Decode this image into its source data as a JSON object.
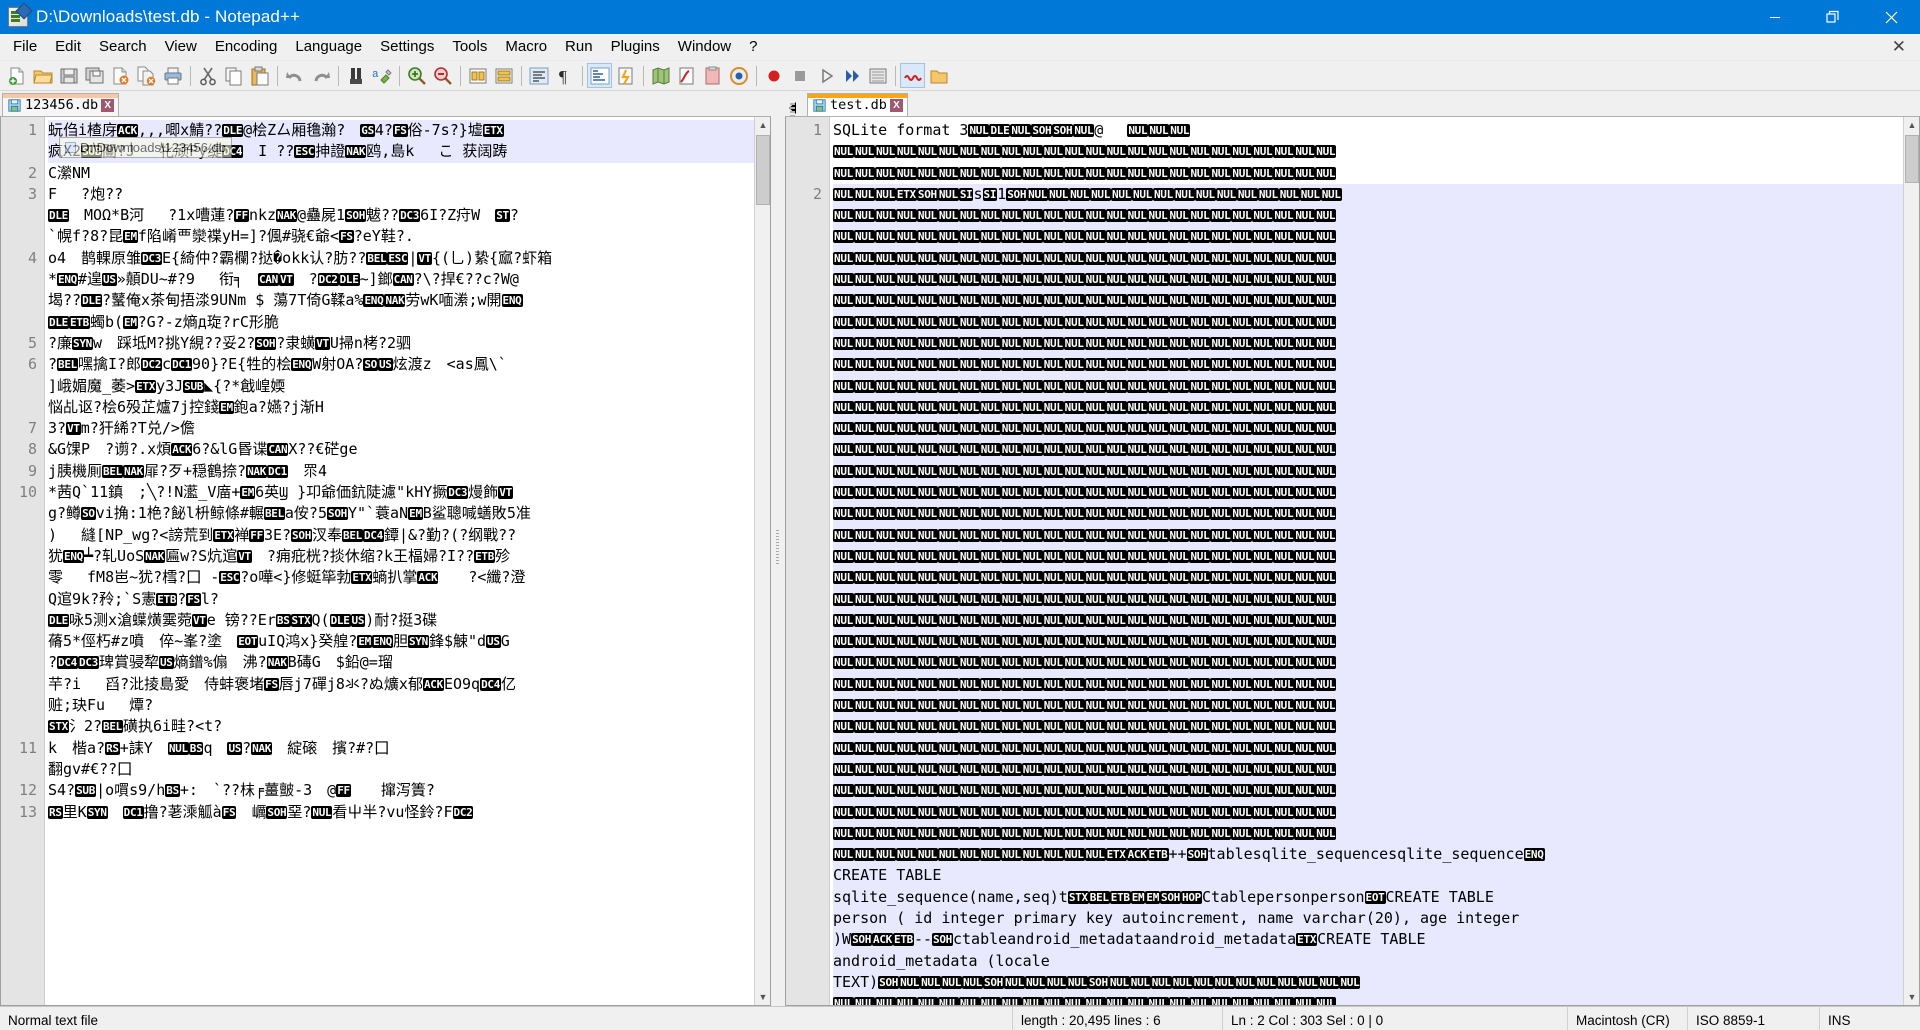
{
  "window": {
    "title": "D:\\Downloads\\test.db - Notepad++",
    "icon": "notepad-plus-plus-icon",
    "accent_color": "#0078d7",
    "controls": {
      "minimize": "minimize-icon",
      "maximize": "restore-icon",
      "close": "close-icon"
    }
  },
  "menubar": {
    "items": [
      "File",
      "Edit",
      "Search",
      "View",
      "Encoding",
      "Language",
      "Settings",
      "Tools",
      "Macro",
      "Run",
      "Plugins",
      "Window",
      "?"
    ],
    "close_document": "✕"
  },
  "toolbar": {
    "icons": [
      "new-file-icon",
      "open-file-icon",
      "save-icon",
      "save-all-icon",
      "close-file-icon",
      "close-all-files-icon",
      "print-icon",
      "sep",
      "cut-icon",
      "copy-icon",
      "paste-icon",
      "sep",
      "undo-icon",
      "redo-icon",
      "sep",
      "find-icon",
      "replace-icon",
      "sep",
      "zoom-in-icon",
      "zoom-out-icon",
      "sep",
      "sync-vertical-scrolling-icon",
      "sync-horizontal-scrolling-icon",
      "sep",
      "word-wrap-icon",
      "show-all-characters-icon",
      "sep",
      "indent-guideline-icon",
      "user-defined-language-icon",
      "sep",
      "document-map-icon",
      "function-list-icon",
      "folder-as-workspace-icon",
      "monitoring-icon",
      "sep",
      "start-recording-icon",
      "stop-recording-icon",
      "playback-icon",
      "run-macro-multiple-times-icon",
      "save-current-recorded-macro-icon",
      "sep",
      "squiggly-underline-icon",
      "open-folder-icon"
    ]
  },
  "left_pane": {
    "tab": {
      "label": "123456.db",
      "icon": "save-icon",
      "close": "X",
      "state": "inactive"
    },
    "tooltip": {
      "text": "D:\\Downloads\\123456.db",
      "icon": "file-icon"
    },
    "gutter_lines": [
      "1",
      "2",
      "3",
      "4",
      "5",
      "6",
      "7",
      "8",
      "9",
      "10",
      "11",
      "12",
      "13"
    ],
    "lines": [
      {
        "n": "1",
        "selected": true,
        "parts": [
          {
            "t": "蚖㑇i楂庌"
          },
          {
            "c": "ACK"
          },
          {
            "t": ",,,唧x鯖??"
          },
          {
            "c": "DLE"
          },
          {
            "t": "@桧Z厶厢氇瀚?　"
          },
          {
            "c": "GS"
          },
          {
            "t": "4?"
          },
          {
            "c": "FS"
          },
          {
            "t": "俗-7s?}墟"
          },
          {
            "c": "ETX"
          },
          {
            "t": "\n疯X2"
          },
          {
            "c": "SUB"
          },
          {
            "t": "闦?J　 牝顽Py缇"
          },
          {
            "c": "DC4"
          },
          {
            "t": "　I ??"
          },
          {
            "c": "ESC"
          },
          {
            "t": "抻證"
          },
          {
            "c": "NAK"
          },
          {
            "t": "鸥,島k　 こ 获阔踌"
          }
        ]
      },
      {
        "n": "2",
        "selected": false,
        "parts": [
          {
            "t": "C瀠NM"
          }
        ]
      },
      {
        "n": "3",
        "selected": false,
        "parts": [
          {
            "t": "F 　?炮??"
          },
          {
            "t": "\n"
          },
          {
            "c": "DLE"
          },
          {
            "t": "　MOΩ*B河　 ?1x嘈蓮?"
          },
          {
            "c": "FF"
          },
          {
            "t": "nkz"
          },
          {
            "c": "NAK"
          },
          {
            "t": "@蠱屍1"
          },
          {
            "c": "SOH"
          },
          {
            "t": "魃??"
          },
          {
            "c": "DC3"
          },
          {
            "t": "6I?Z疛W　"
          },
          {
            "c": "ST"
          },
          {
            "t": "?"
          },
          {
            "t": "\n`幌f?8?昆"
          },
          {
            "c": "EM"
          },
          {
            "t": "f陷崤覀灓褋yH=]?偑#骁€爺<"
          },
          {
            "c": "FS"
          },
          {
            "t": "?eY鞋?."
          }
        ]
      },
      {
        "n": "4",
        "selected": false,
        "parts": [
          {
            "t": "o4　鹊輠原雏"
          },
          {
            "c": "DC3"
          },
          {
            "t": "E{綺仲?霸欄?挞�okk认?肪??"
          },
          {
            "c": "BEL"
          },
          {
            "c": "ESC"
          },
          {
            "t": "|"
          },
          {
            "c": "VT"
          },
          {
            "t": "{(乚)絷{寙?虾箱"
          },
          {
            "t": "\n*"
          },
          {
            "c": "ENQ"
          },
          {
            "t": "#遑"
          },
          {
            "c": "US"
          },
          {
            "t": "»顤DU~#?9　 衔╕　"
          },
          {
            "c": "CAN"
          },
          {
            "c": "VT"
          },
          {
            "t": "　?"
          },
          {
            "c": "DC2"
          },
          {
            "c": "DLE"
          },
          {
            "t": "~]鎯"
          },
          {
            "c": "CAN"
          },
          {
            "t": "?\\?捍€??c?W@"
          },
          {
            "t": "\n堨??"
          },
          {
            "c": "DLE"
          },
          {
            "t": "?鼜俺x茶甸捂渁9UNm $ 蕩7T倚G鞣a%"
          },
          {
            "c": "ENQ"
          },
          {
            "c": "NAK"
          },
          {
            "t": "劳wK喕潫;w開"
          },
          {
            "c": "ENQ"
          },
          {
            "t": "\n"
          },
          {
            "c": "DLE"
          },
          {
            "c": "ETB"
          },
          {
            "t": "蠋b("
          },
          {
            "c": "EM"
          },
          {
            "t": "?G?-z熵д琁?rC形脆"
          }
        ]
      },
      {
        "n": "5",
        "selected": false,
        "parts": [
          {
            "t": "?廉"
          },
          {
            "c": "SYN"
          },
          {
            "t": "w　踩坻M?挑Y絸??妥2?"
          },
          {
            "c": "SOH"
          },
          {
            "t": "?隶蟥"
          },
          {
            "c": "VT"
          },
          {
            "t": "U掃n栲?2驷"
          }
        ]
      },
      {
        "n": "6",
        "selected": false,
        "parts": [
          {
            "t": "?"
          },
          {
            "c": "BEL"
          },
          {
            "t": "嘿擒I?郎"
          },
          {
            "c": "DC2"
          },
          {
            "t": "c"
          },
          {
            "c": "DC1"
          },
          {
            "t": "90}?E{牲的桧"
          },
          {
            "c": "ENQ"
          },
          {
            "t": "W射OA?"
          },
          {
            "c": "SO"
          },
          {
            "c": "US"
          },
          {
            "t": "炫渡z　<as鳳\\`"
          },
          {
            "t": "\n]峨媚魔_萎>"
          },
          {
            "c": "ETX"
          },
          {
            "t": "y3J"
          },
          {
            "c": "SUB"
          },
          {
            "t": "◣{?*戧崲媆"
          },
          {
            "t": "\n悩乩讴?桧6殁芷爐7j控錢"
          },
          {
            "c": "EM"
          },
          {
            "t": "鉋a?嬿?j渐H"
          }
        ]
      },
      {
        "n": "7",
        "selected": false,
        "parts": [
          {
            "t": "3?"
          },
          {
            "c": "VT"
          },
          {
            "t": "m?犴絺?T兑/>儋"
          }
        ]
      },
      {
        "n": "8",
        "selected": false,
        "parts": [
          {
            "t": "&G馃P　?谫?.x煩"
          },
          {
            "c": "ACK"
          },
          {
            "t": "6?&lG昬谍"
          },
          {
            "c": "CAN"
          },
          {
            "t": "X??€硭ge"
          }
        ]
      },
      {
        "n": "9",
        "selected": false,
        "parts": [
          {
            "t": "j胰機厠"
          },
          {
            "c": "BEL"
          },
          {
            "c": "NAK"
          },
          {
            "t": "屝?歹+穏鶴捺?"
          },
          {
            "c": "NAK"
          },
          {
            "c": "DC1"
          },
          {
            "t": "　眔4"
          }
        ]
      },
      {
        "n": "10",
        "selected": false,
        "parts": [
          {
            "t": "*茜Q`11鎮　;╲?!N灆_V庿+"
          },
          {
            "c": "EM"
          },
          {
            "t": "6英Ϣ }卭爺価鈧陡濾\"kHY撅"
          },
          {
            "c": "DC3"
          },
          {
            "t": "熳飾"
          },
          {
            "c": "VT"
          },
          {
            "t": "\ng?鳟"
          },
          {
            "c": "SO"
          },
          {
            "t": "vi捔:1栬?飶l枡鲸條#輾"
          },
          {
            "c": "BEL"
          },
          {
            "t": "a侒?5"
          },
          {
            "c": "SOH"
          },
          {
            "t": "Y\"`蓑aN"
          },
          {
            "c": "EM"
          },
          {
            "t": "B鲨聰喊蟮敗5准"
          },
          {
            "t": "\n)　 縫[NP_wg?<謗荒到"
          },
          {
            "c": "ETX"
          },
          {
            "t": "褝"
          },
          {
            "c": "FF"
          },
          {
            "t": "3E?"
          },
          {
            "c": "SOH"
          },
          {
            "t": "汊奉"
          },
          {
            "c": "BEL"
          },
          {
            "c": "DC4"
          },
          {
            "t": "鐔|&?勤?(?纲戰??"
          },
          {
            "t": "\n犹"
          },
          {
            "c": "ENQ"
          },
          {
            "t": "┷?轧UoS"
          },
          {
            "c": "NAK"
          },
          {
            "t": "匾w?S炕逭"
          },
          {
            "c": "VT"
          },
          {
            "t": "　?痈疪桄?掞休缩?k王楅婦?I??"
          },
          {
            "c": "ETB"
          },
          {
            "t": "殄"
          },
          {
            "t": "\n零　 fM8岜~犹?樰?囗 -"
          },
          {
            "c": "ESC"
          },
          {
            "t": "?o嘩<}修蜓筚勃"
          },
          {
            "c": "ETX"
          },
          {
            "t": "螪扒掌"
          },
          {
            "c": "ACK"
          },
          {
            "t": "　　?<纖?澄"
          },
          {
            "t": "\nQ逭9k?矝;`S憲"
          },
          {
            "c": "ETB"
          },
          {
            "t": "?"
          },
          {
            "c": "FS"
          },
          {
            "t": "l?"
          },
          {
            "t": "\n"
          },
          {
            "c": "DLE"
          },
          {
            "t": "咏5测x滄蠂熿霙菀"
          },
          {
            "c": "VT"
          },
          {
            "t": "e 镑??Er"
          },
          {
            "c": "BS"
          },
          {
            "c": "STX"
          },
          {
            "t": "Q("
          },
          {
            "c": "DLE"
          },
          {
            "c": "US"
          },
          {
            "t": ")耐?挺3碟"
          },
          {
            "t": "\n蓨5*俓朽#z噴　倅~峯?塗　"
          },
          {
            "c": "EOT"
          },
          {
            "t": "uIQ鸿x}癸艎?"
          },
          {
            "c": "EM"
          },
          {
            "c": "ENQ"
          },
          {
            "t": "胆"
          },
          {
            "c": "SYN"
          },
          {
            "t": "鋒$觫\"d"
          },
          {
            "c": "US"
          },
          {
            "t": "G"
          },
          {
            "t": "\n?"
          },
          {
            "c": "DC4"
          },
          {
            "c": "DC3"
          },
          {
            "t": "琕賞骎犂"
          },
          {
            "c": "US"
          },
          {
            "t": "熵鐠%傓　沸?"
          },
          {
            "c": "NAK"
          },
          {
            "t": "B碡G　$鉛@=瑠"
          },
          {
            "t": "\n芉?i　 舀?沘掕島愛　侍蚌褒堵"
          },
          {
            "c": "FS"
          },
          {
            "t": "唇j7磾j8氺?ぬ爌x郁"
          },
          {
            "c": "ACK"
          },
          {
            "t": "EO9q"
          },
          {
            "c": "DC4"
          },
          {
            "t": "亿"
          },
          {
            "t": "\n赃;玦Fu　 燂?"
          }
        ]
      },
      {
        "n": "11",
        "selected": false,
        "parts": [
          {
            "c": "STX"
          },
          {
            "t": "氵2?"
          },
          {
            "c": "BEL"
          },
          {
            "t": "磺执6i畦?<t?"
          },
          {
            "t": "\nk　楷a?"
          },
          {
            "c": "RS"
          },
          {
            "t": "+誄Y　"
          },
          {
            "c": "NUL"
          },
          {
            "c": "BS"
          },
          {
            "t": "q　"
          },
          {
            "c": "US"
          },
          {
            "t": "?"
          },
          {
            "c": "NAK"
          },
          {
            "t": "　綻磙　擯?#?囗"
          }
        ]
      },
      {
        "n": "12",
        "selected": false,
        "parts": [
          {
            "t": "翻gv#€??囗"
          }
        ]
      },
      {
        "n": "13",
        "selected": false,
        "parts": [
          {
            "t": "S4?"
          },
          {
            "c": "SUB"
          },
          {
            "t": "|o嘪s9/h"
          },
          {
            "c": "BS"
          },
          {
            "t": "+:　`??枺╒薑皽-3　@"
          },
          {
            "c": "FF"
          },
          {
            "t": "　　撺泻簀?"
          },
          {
            "t": "\n"
          },
          {
            "c": "RS"
          },
          {
            "t": "里K"
          },
          {
            "c": "SYN"
          },
          {
            "t": "　"
          },
          {
            "c": "DC1"
          },
          {
            "t": "撸?荖溗觚à"
          },
          {
            "c": "FS"
          },
          {
            "t": "　巁"
          },
          {
            "c": "SOH"
          },
          {
            "t": "堊?"
          },
          {
            "c": "NUL"
          },
          {
            "t": "看屮半?vu怪鈴?F"
          },
          {
            "c": "DC2"
          }
        ]
      }
    ]
  },
  "right_pane": {
    "tab": {
      "label": "test.db",
      "icon": "save-icon",
      "close": "X",
      "state": "active"
    },
    "gutter_lines": [
      "1",
      "2"
    ],
    "lines": [
      {
        "n": "1",
        "selected": false,
        "parts": [
          {
            "t": "SQLite format 3"
          },
          {
            "c": "NUL"
          },
          {
            "c": "DLE"
          },
          {
            "c": "NUL"
          },
          {
            "c": "SOH"
          },
          {
            "c": "SOH"
          },
          {
            "c": "NUL"
          },
          {
            "t": "@　 "
          },
          {
            "c": "NUL"
          },
          {
            "c": "NUL"
          },
          {
            "c": "NUL"
          }
        ]
      },
      {
        "n": "",
        "selected": false,
        "nul_row": 16,
        "tail": []
      },
      {
        "n": "",
        "selected": false,
        "nul_row": 16,
        "tail": []
      },
      {
        "n": "2",
        "selected": true,
        "parts": [
          {
            "c": "NUL"
          },
          {
            "c": "NUL"
          },
          {
            "c": "NUL"
          },
          {
            "c": "ETX"
          },
          {
            "c": "SOH"
          },
          {
            "c": "NUL"
          },
          {
            "c": "SI"
          },
          {
            "t": "s"
          },
          {
            "c": "SI"
          },
          {
            "t": "1"
          },
          {
            "c": "SOH"
          },
          {
            "c": "NUL"
          },
          {
            "c": "NUL"
          },
          {
            "c": "NUL"
          },
          {
            "c": "NUL"
          },
          {
            "c": "NUL"
          },
          {
            "c": "NUL"
          },
          {
            "c": "NUL"
          },
          {
            "c": "NUL"
          },
          {
            "c": "NUL"
          }
        ]
      }
    ],
    "sql_text": [
      "CREATE TABLE",
      "sqlite_sequence(name,seq)t",
      "person ( id integer primary key autoincrement, name varchar(20), age integer",
      ")W",
      "android_metadata (locale",
      "TEXT)"
    ],
    "sql_tokens": {
      "line2_ctrl": [
        "STX",
        "BEL",
        "ETB",
        "EM",
        "EM",
        "SOH",
        "HOP"
      ],
      "line2_after": "Ctablepersonperson",
      "line2_eot": "EOT",
      "line2_tail": "CREATE TABLE",
      "line4_ctrl": [
        "SOH",
        "ACK",
        "ETB"
      ],
      "line4_mid": "--",
      "line4_ctrl2": [
        "SOH"
      ],
      "line4_after": "ctableandroid_metadataandroid_metadata",
      "line4_etx": "ETX",
      "line4_tail": "CREATE TABLE",
      "tables_line": "tablesqlite_sequencesqlite_sequence",
      "tables_ctrl": [
        "ETX",
        "ACK",
        "ETB"
      ],
      "tables_plus": "++",
      "tables_soh": "SOH",
      "tables_enq": "ENQ"
    },
    "nul_label": "NUL"
  },
  "statusbar": {
    "doc_type": "Normal text file",
    "length_lines": "length : 20,495   lines : 6",
    "position": "Ln : 2    Col : 303    Sel : 0 | 0",
    "eol": "Macintosh (CR)",
    "encoding": "ISO 8859-1",
    "insert_mode": "INS"
  }
}
